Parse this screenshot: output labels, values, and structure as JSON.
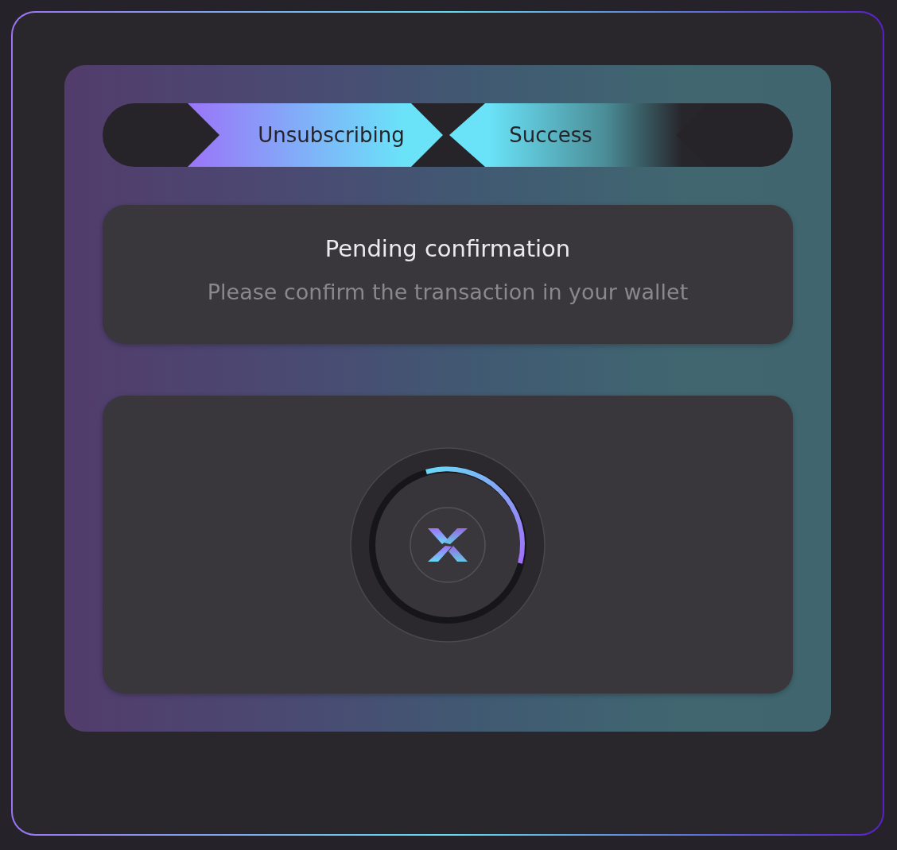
{
  "steps": [
    {
      "label": "Unsubscribing",
      "current": true
    },
    {
      "label": "Success",
      "current": false
    }
  ],
  "status": {
    "title": "Pending confirmation",
    "message": "Please confirm the transaction in your wallet"
  }
}
